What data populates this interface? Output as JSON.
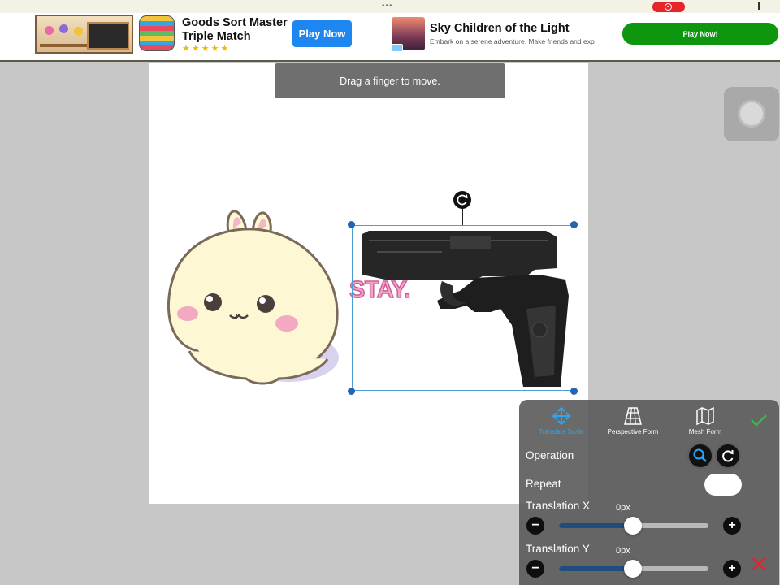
{
  "status_bar": {
    "dots": "•••"
  },
  "ads": {
    "goods": {
      "title": "Goods Sort Master Triple Match",
      "stars": "★★★★★",
      "play_label": "Play Now"
    },
    "sky": {
      "title": "Sky Children of the Light",
      "subtitle": "Embark on a serene adventure. Make friends and exp",
      "play_label": "Play Now!"
    }
  },
  "toast": {
    "text": "Drag a finger to move."
  },
  "canvas": {
    "sticker_text": "STAY."
  },
  "panel": {
    "tools": [
      {
        "label": "Translate Scale",
        "icon": "move-arrows-icon",
        "active": true
      },
      {
        "label": "Perspective Form",
        "icon": "perspective-grid-icon",
        "active": false
      },
      {
        "label": "Mesh Form",
        "icon": "mesh-map-icon",
        "active": false
      }
    ],
    "operation_label": "Operation",
    "repeat_label": "Repeat",
    "repeat_on": false,
    "translation_x": {
      "label": "Translation X",
      "value": "0px",
      "position": 0.5
    },
    "translation_y": {
      "label": "Translation Y",
      "value": "0px",
      "position": 0.5
    }
  },
  "colors": {
    "accent": "#29a7f2",
    "confirm": "#3db54a",
    "cancel": "#e0262b",
    "slider_fill": "#1f4d7e"
  }
}
